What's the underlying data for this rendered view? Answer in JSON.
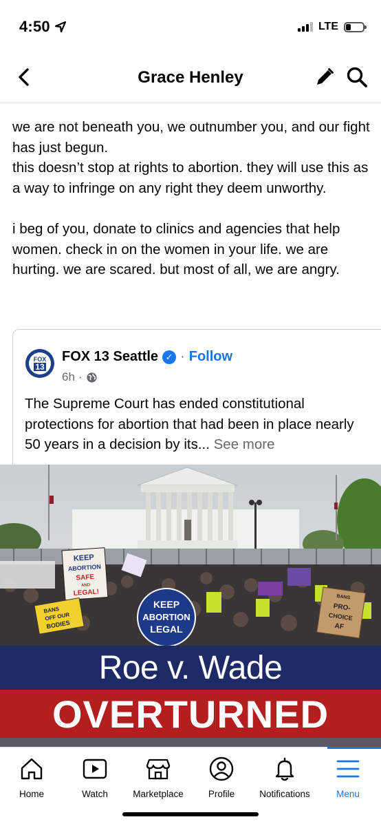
{
  "status_bar": {
    "time": "4:50",
    "network": "LTE",
    "battery_percent": 30
  },
  "header": {
    "title": "Grace Henley"
  },
  "post": {
    "text": "we are not beneath you, we outnumber you, and our fight has just begun.\nthis doesn’t stop at rights to abortion. they will use this as a way to infringe on any right they deem unworthy.\n\ni beg of you, donate to clinics and agencies that help women. check in on the women in your life. we are hurting. we are scared. but most of all, we are angry."
  },
  "shared": {
    "logo_top": "FOX",
    "logo_num": "13",
    "source_name": "FOX 13 Seattle",
    "separator": "·",
    "follow_label": "Follow",
    "time_ago": "6h",
    "meta_sep": "·",
    "description": "The Supreme Court has ended constitutional protections for abortion that had been in place nearly 50 years in a decision by its...",
    "see_more": "See more",
    "image": {
      "signs": [
        "KEEP",
        "ABORTION",
        "SAFE",
        "AND",
        "LEGAL!",
        "BANS",
        "OFF OUR",
        "BODIES",
        "KEEP",
        "ABORTION",
        "LEGAL",
        "BANS",
        "PRO-",
        "CHOICE",
        "AF"
      ],
      "banner_top": "Roe v. Wade",
      "banner_bottom": "OVERTURNED"
    }
  },
  "nav": {
    "items": [
      {
        "label": "Home",
        "icon": "home-icon"
      },
      {
        "label": "Watch",
        "icon": "watch-icon"
      },
      {
        "label": "Marketplace",
        "icon": "marketplace-icon"
      },
      {
        "label": "Profile",
        "icon": "profile-icon"
      },
      {
        "label": "Notifications",
        "icon": "bell-icon"
      },
      {
        "label": "Menu",
        "icon": "menu-icon"
      }
    ],
    "active": "Menu"
  },
  "colors": {
    "link_blue": "#1b74e4",
    "verified_blue": "#1877f2",
    "banner_navy": "#1d2a66",
    "banner_red": "#b41e1e"
  }
}
